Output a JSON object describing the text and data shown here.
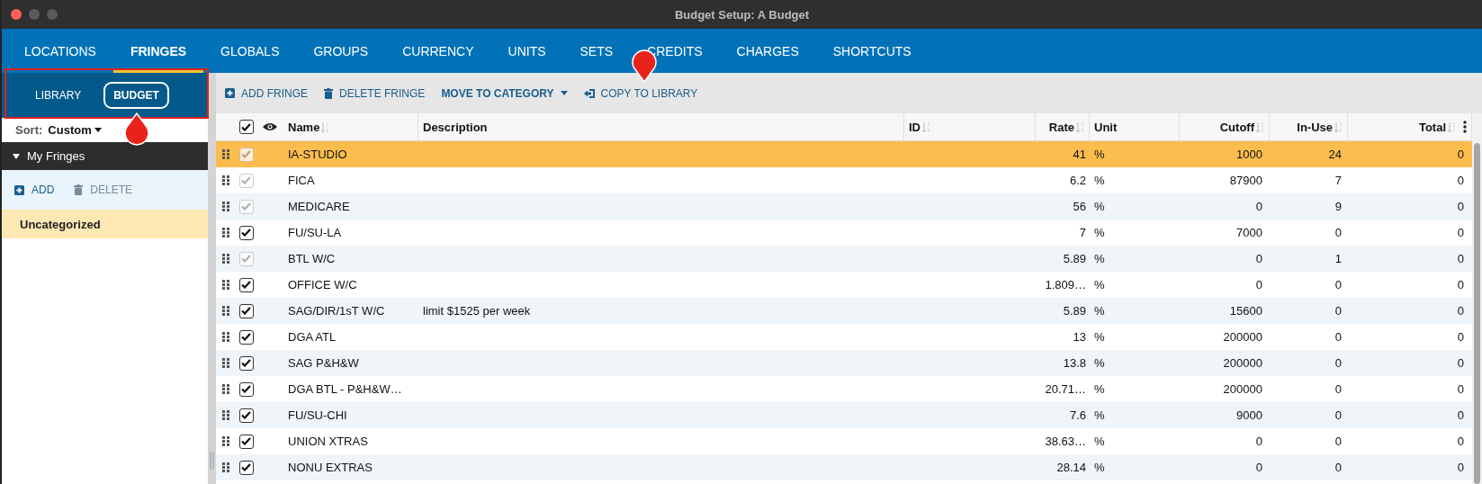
{
  "window": {
    "title": "Budget Setup: A Budget"
  },
  "tabs": [
    {
      "label": "LOCATIONS",
      "selected": false
    },
    {
      "label": "FRINGES",
      "selected": true
    },
    {
      "label": "GLOBALS",
      "selected": false
    },
    {
      "label": "GROUPS",
      "selected": false
    },
    {
      "label": "CURRENCY",
      "selected": false
    },
    {
      "label": "UNITS",
      "selected": false
    },
    {
      "label": "SETS",
      "selected": false
    },
    {
      "label": "CREDITS",
      "selected": false
    },
    {
      "label": "CHARGES",
      "selected": false
    },
    {
      "label": "SHORTCUTS",
      "selected": false
    }
  ],
  "sidebar": {
    "modes": [
      {
        "label": "LIBRARY",
        "selected": false
      },
      {
        "label": "BUDGET",
        "selected": true
      }
    ],
    "sort": {
      "label": "Sort:",
      "value": "Custom"
    },
    "group": {
      "title": "My Fringes",
      "expanded": true
    },
    "actions": [
      {
        "label": "ADD",
        "kind": "add"
      },
      {
        "label": "DELETE",
        "kind": "delete"
      }
    ],
    "categories": [
      {
        "label": "Uncategorized",
        "selected": true
      }
    ]
  },
  "toolbar": [
    {
      "label": "ADD FRINGE",
      "kind": "add"
    },
    {
      "label": "DELETE FRINGE",
      "kind": "delete"
    },
    {
      "label": "MOVE TO CATEGORY",
      "kind": "menu"
    },
    {
      "label": "COPY TO LIBRARY",
      "kind": "copy"
    }
  ],
  "table": {
    "all_checked": true,
    "columns": [
      {
        "label": "Name",
        "sortable": true
      },
      {
        "label": "Description",
        "sortable": false
      },
      {
        "label": "ID",
        "sortable": true
      },
      {
        "label": "Rate",
        "sortable": true
      },
      {
        "label": "Unit",
        "sortable": false
      },
      {
        "label": "Cutoff",
        "sortable": true
      },
      {
        "label": "In-Use",
        "sortable": true
      },
      {
        "label": "Total",
        "sortable": true,
        "menu": true
      }
    ],
    "rows": [
      {
        "name": "IA-STUDIO",
        "rate": "41",
        "unit": "%",
        "cutoff": "1000",
        "in_use": "24",
        "total": "0",
        "checked": true,
        "disabled": true,
        "selected": true
      },
      {
        "name": "FICA",
        "rate": "6.2",
        "unit": "%",
        "cutoff": "87900",
        "in_use": "7",
        "total": "0",
        "checked": true,
        "disabled": true,
        "selected": false
      },
      {
        "name": "MEDICARE",
        "rate": "56",
        "unit": "%",
        "cutoff": "0",
        "in_use": "9",
        "total": "0",
        "checked": true,
        "disabled": true,
        "selected": false
      },
      {
        "name": "FU/SU-LA",
        "rate": "7",
        "unit": "%",
        "cutoff": "7000",
        "in_use": "0",
        "total": "0",
        "checked": true,
        "disabled": false,
        "selected": false
      },
      {
        "name": "BTL W/C",
        "rate": "5.89",
        "unit": "%",
        "cutoff": "0",
        "in_use": "1",
        "total": "0",
        "checked": true,
        "disabled": true,
        "selected": false
      },
      {
        "name": "OFFICE W/C",
        "rate": "1.809…",
        "unit": "%",
        "cutoff": "0",
        "in_use": "0",
        "total": "0",
        "checked": true,
        "disabled": false,
        "selected": false
      },
      {
        "name": "SAG/DIR/1sT W/C",
        "description": "limit $1525 per week",
        "rate": "5.89",
        "unit": "%",
        "cutoff": "15600",
        "in_use": "0",
        "total": "0",
        "checked": true,
        "disabled": false,
        "selected": false
      },
      {
        "name": "DGA ATL",
        "rate": "13",
        "unit": "%",
        "cutoff": "200000",
        "in_use": "0",
        "total": "0",
        "checked": true,
        "disabled": false,
        "selected": false
      },
      {
        "name": "SAG P&H&W",
        "rate": "13.8",
        "unit": "%",
        "cutoff": "200000",
        "in_use": "0",
        "total": "0",
        "checked": true,
        "disabled": false,
        "selected": false
      },
      {
        "name": "DGA BTL - P&H&W…",
        "rate": "20.71…",
        "unit": "%",
        "cutoff": "200000",
        "in_use": "0",
        "total": "0",
        "checked": true,
        "disabled": false,
        "selected": false
      },
      {
        "name": "FU/SU-CHI",
        "rate": "7.6",
        "unit": "%",
        "cutoff": "9000",
        "in_use": "0",
        "total": "0",
        "checked": true,
        "disabled": false,
        "selected": false
      },
      {
        "name": "UNION XTRAS",
        "rate": "38.63…",
        "unit": "%",
        "cutoff": "0",
        "in_use": "0",
        "total": "0",
        "checked": true,
        "disabled": false,
        "selected": false
      },
      {
        "name": "NONU EXTRAS",
        "rate": "28.14",
        "unit": "%",
        "cutoff": "0",
        "in_use": "0",
        "total": "0",
        "checked": true,
        "disabled": false,
        "selected": false
      }
    ]
  }
}
